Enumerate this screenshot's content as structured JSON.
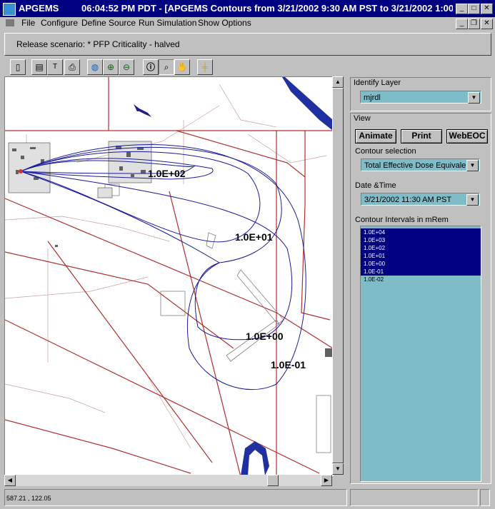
{
  "window": {
    "app_name": "APGEMS",
    "title_text": "06:04:52 PM PDT - [APGEMS Contours from 3/21/2002 9:30 AM PST to 3/21/2002 1:00 ..."
  },
  "menu": [
    "File",
    "Configure",
    "Define Source",
    "Run Simulation",
    "Show Options"
  ],
  "scenario_text": "Release scenario: * PFP Criticality - halved",
  "toolbar_icons": [
    "new-doc-icon",
    "properties-icon",
    "text-icon",
    "print-icon",
    "globe-icon",
    "zoom-in-icon",
    "zoom-out-icon",
    "info-icon",
    "magnifier-icon",
    "pan-hand-icon",
    "crosshair-icon"
  ],
  "map": {
    "contour_labels": [
      "1.0E+02",
      "1.0E+01",
      "1.0E+00",
      "1.0E-01"
    ]
  },
  "identify": {
    "label": "Identify Layer",
    "value": "mjrdl"
  },
  "view": {
    "label": "View",
    "animate": "Animate",
    "print": "Print",
    "webeoc": "WebEOC",
    "contour_label": "Contour selection",
    "contour_value": "Total Effective Dose Equivalen",
    "date_label": "Date &Time",
    "date_value": "3/21/2002 11:30 AM PST",
    "intervals_label": "Contour Intervals in mRem",
    "intervals": [
      "1.0E+04",
      "1.0E+03",
      "1.0E+02",
      "1.0E+01",
      "1.0E+00",
      "1.0E-01",
      "1.0E-02"
    ]
  },
  "status": {
    "coords": "587.21 , 122.05"
  },
  "colors": {
    "titlebar": "#000080",
    "map_bg": "#ffffff",
    "road": "#b03030",
    "contour": "#1a1aa0",
    "river": "#2030a0",
    "list_bg": "#7fbcc8",
    "list_selected": "#000080"
  }
}
